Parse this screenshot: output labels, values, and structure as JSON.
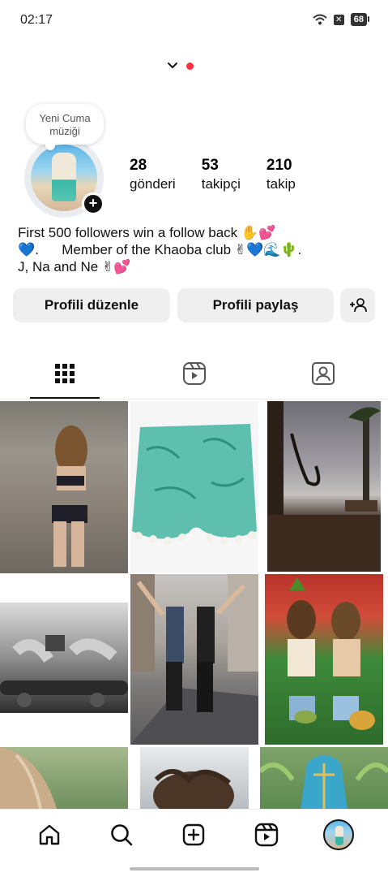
{
  "status_bar": {
    "time": "02:17",
    "battery": "68",
    "icons": [
      "wifi-icon",
      "x-box-icon",
      "battery-icon"
    ]
  },
  "header": {
    "icons": [
      "chevron-down-icon",
      "notification-dot"
    ]
  },
  "note": {
    "text": "Yeni Cuma müziği"
  },
  "profile": {
    "stats": [
      {
        "value": "28",
        "label": "gönderi"
      },
      {
        "value": "53",
        "label": "takipçi"
      },
      {
        "value": "210",
        "label": "takip"
      }
    ],
    "bio": [
      "First 500 followers win a follow back ✋💕",
      "💙.      Member of the Khaoba club ✌💙🌊🌵.",
      "J, Na and Ne ✌💕"
    ]
  },
  "buttons": {
    "edit": "Profili düzenle",
    "share": "Profili paylaş",
    "add_user_icon": "add-person-icon"
  },
  "tabs": [
    {
      "icon": "grid-icon",
      "active": true
    },
    {
      "icon": "reels-icon",
      "active": false
    },
    {
      "icon": "tagged-icon",
      "active": false
    }
  ],
  "bottom_nav": [
    "home-icon",
    "search-icon",
    "create-icon",
    "reels-icon",
    "profile-avatar"
  ],
  "colors": {
    "accent_red": "#ff3040",
    "button_bg": "#efefef",
    "text": "#111111"
  }
}
